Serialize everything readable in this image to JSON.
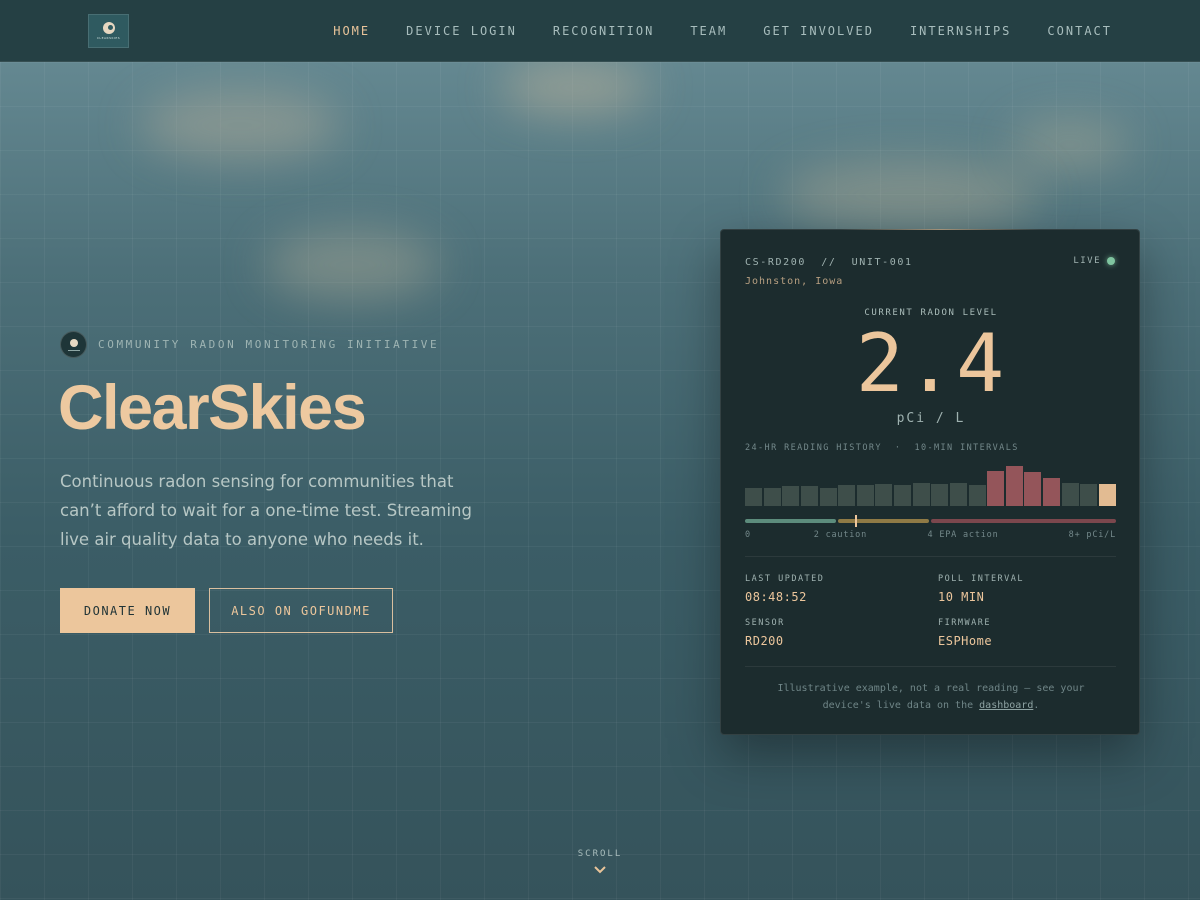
{
  "nav": {
    "logo_text": "CLEARSKIES",
    "links": [
      "HOME",
      "DEVICE LOGIN",
      "RECOGNITION",
      "TEAM",
      "GET INVOLVED",
      "INTERNSHIPS",
      "CONTACT"
    ],
    "active": "HOME"
  },
  "hero": {
    "eyebrow": "COMMUNITY RADON MONITORING INITIATIVE",
    "title": "ClearSkies",
    "description": "Continuous radon sensing for communities that can’t afford to wait for a one-time test. Streaming live air quality data to anyone who needs it.",
    "donate_label": "DONATE NOW",
    "gofundme_label": "ALSO ON GOFUNDME"
  },
  "card": {
    "device_id": "CS-RD200  //  UNIT-001",
    "location": "Johnston, Iowa",
    "live_label": "LIVE",
    "current_label": "CURRENT RADON LEVEL",
    "reading": "2.4",
    "unit": "pCi / L",
    "history_label": "24-HR READING HISTORY  ·  10-MIN INTERVALS",
    "history_values": [
      1.2,
      1.2,
      1.3,
      1.3,
      1.2,
      1.4,
      1.4,
      1.5,
      1.4,
      1.6,
      1.5,
      1.6,
      1.4,
      2.6,
      3.0,
      2.5,
      2.0,
      1.6,
      1.5,
      1.5
    ],
    "history_colors": {
      "normal": "#3e4e4a",
      "elevated": "#94555a",
      "current": "#e2bb92"
    },
    "scale": {
      "max": 8,
      "caution_at": 2,
      "action_at": 4,
      "marker_value": 2.4,
      "colors": {
        "safe": "#5c8c7c",
        "caution": "#8f7a45",
        "action": "#7b474d"
      },
      "labels": [
        "0",
        "2 caution",
        "4 EPA action",
        "8+ pCi/L"
      ]
    },
    "meta": {
      "last_updated_label": "LAST UPDATED",
      "last_updated": "08:48:52",
      "poll_interval_label": "POLL INTERVAL",
      "poll_interval": "10 MIN",
      "sensor_label": "SENSOR",
      "sensor": "RD200",
      "firmware_label": "FIRMWARE",
      "firmware": "ESPHome"
    },
    "footnote_line1": "Illustrative example, not a real reading — see your",
    "footnote_line2_prefix": "device's live data on the",
    "footnote_link": "dashboard",
    "footnote_suffix": "."
  },
  "scroll_label": "SCROLL",
  "icons": [
    "logo-icon",
    "live-dot-icon",
    "chevron-down-icon"
  ]
}
